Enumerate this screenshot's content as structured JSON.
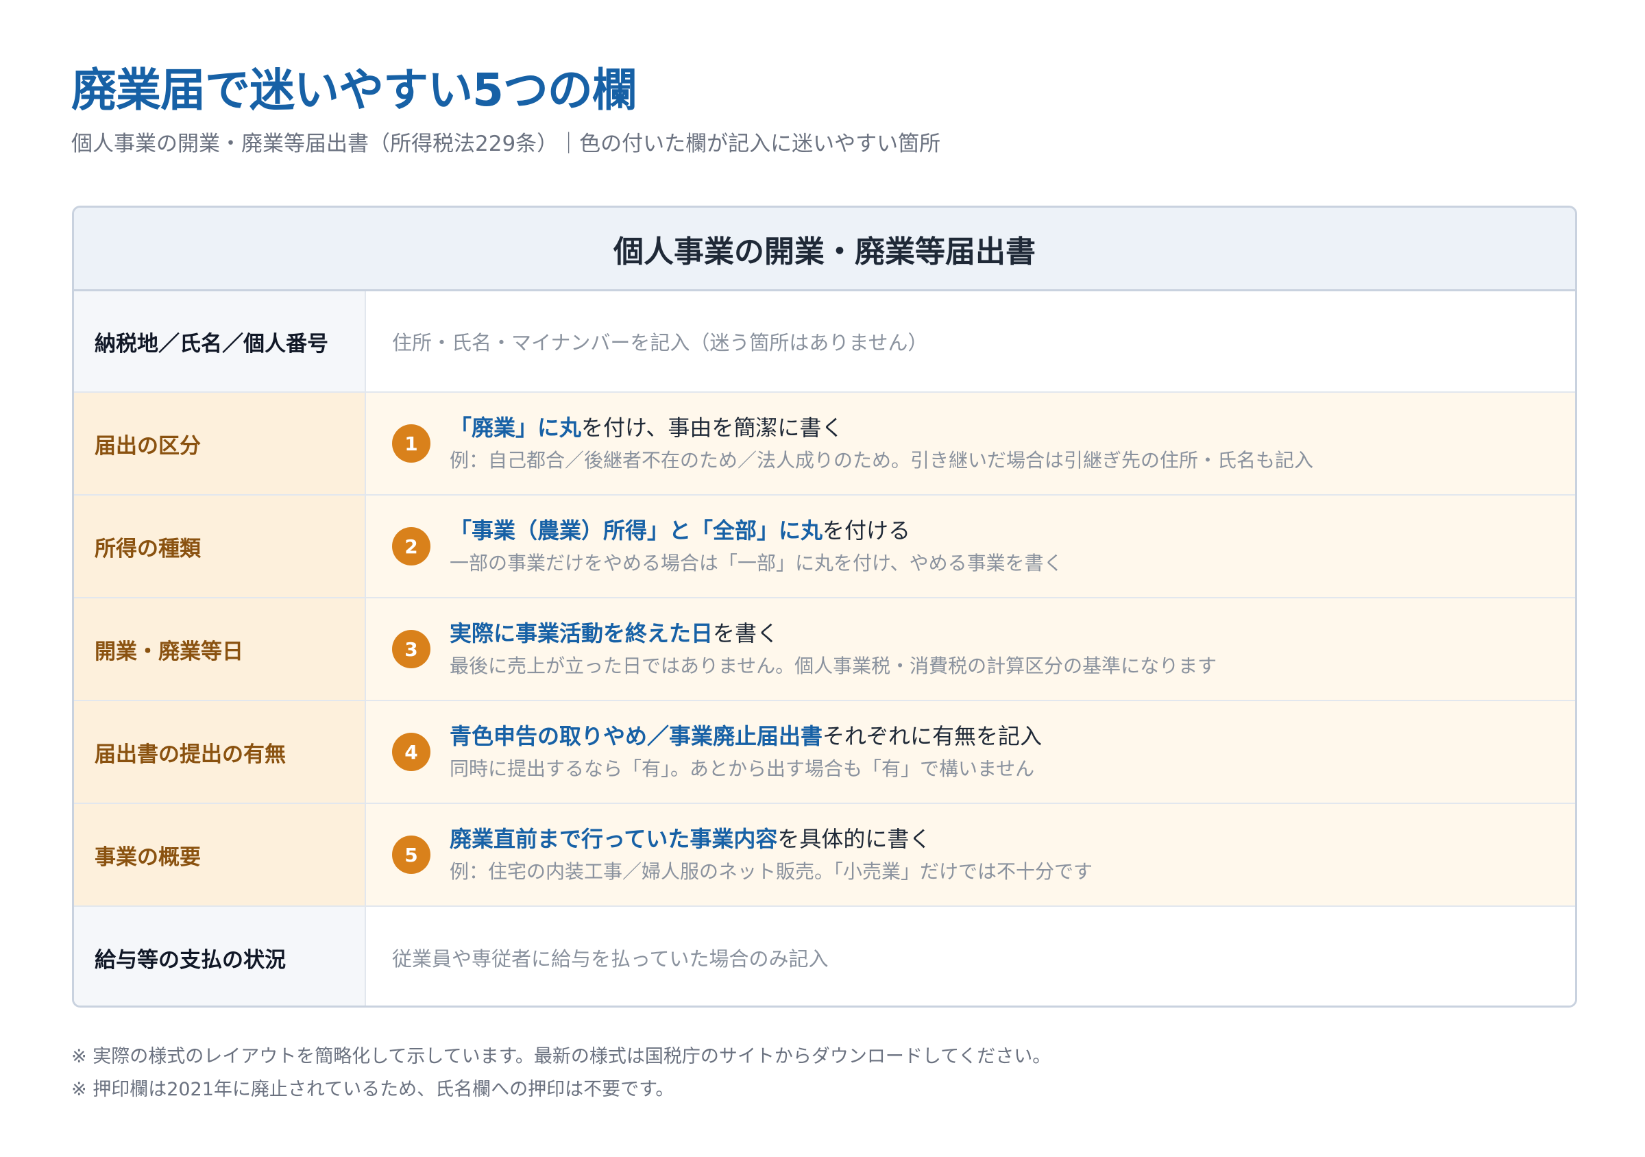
{
  "title": "廃業届で迷いやすい5つの欄",
  "subtitle": "個人事業の開業・廃業等届出書（所得税法229条）｜色の付いた欄が記入に迷いやすい箇所",
  "form": {
    "header": "個人事業の開業・廃業等届出書",
    "rows": [
      {
        "type": "plain",
        "label": "納税地／氏名／個人番号",
        "text": "住所・氏名・マイナンバーを記入（迷う箇所はありません）"
      },
      {
        "type": "highlight",
        "label": "届出の区分",
        "number": "1",
        "emph": "「廃業」に丸",
        "rest": "を付け、事由を簡潔に書く",
        "note": "例：自己都合／後継者不在のため／法人成りのため。引き継いだ場合は引継ぎ先の住所・氏名も記入"
      },
      {
        "type": "highlight",
        "label": "所得の種類",
        "number": "2",
        "emph": "「事業（農業）所得」と「全部」に丸",
        "rest": "を付ける",
        "note": "一部の事業だけをやめる場合は「一部」に丸を付け、やめる事業を書く"
      },
      {
        "type": "highlight",
        "label": "開業・廃業等日",
        "number": "3",
        "emph": "実際に事業活動を終えた日",
        "rest": "を書く",
        "note": "最後に売上が立った日ではありません。個人事業税・消費税の計算区分の基準になります"
      },
      {
        "type": "highlight",
        "label": "届出書の提出の有無",
        "number": "4",
        "emph": "青色申告の取りやめ／事業廃止届出書",
        "rest": "それぞれに有無を記入",
        "note": "同時に提出するなら「有」。あとから出す場合も「有」で構いません"
      },
      {
        "type": "highlight",
        "label": "事業の概要",
        "number": "5",
        "emph": "廃業直前まで行っていた事業内容",
        "rest": "を具体的に書く",
        "note": "例：住宅の内装工事／婦人服のネット販売。「小売業」だけでは不十分です"
      },
      {
        "type": "plain",
        "label": "給与等の支払の状況",
        "text": "従業員や専従者に給与を払っていた場合のみ記入"
      }
    ]
  },
  "notes": [
    "※ 実際の様式のレイアウトを簡略化して示しています。最新の様式は国税庁のサイトからダウンロードしてください。",
    "※ 押印欄は2021年に廃止されているため、氏名欄への押印は不要です。"
  ],
  "colors": {
    "title": "#1761a6",
    "accent_badge": "#d9811b",
    "highlight_label_bg": "#fdf0dc",
    "highlight_content_bg": "#fff8ec",
    "highlight_label_text": "#8a5210"
  }
}
